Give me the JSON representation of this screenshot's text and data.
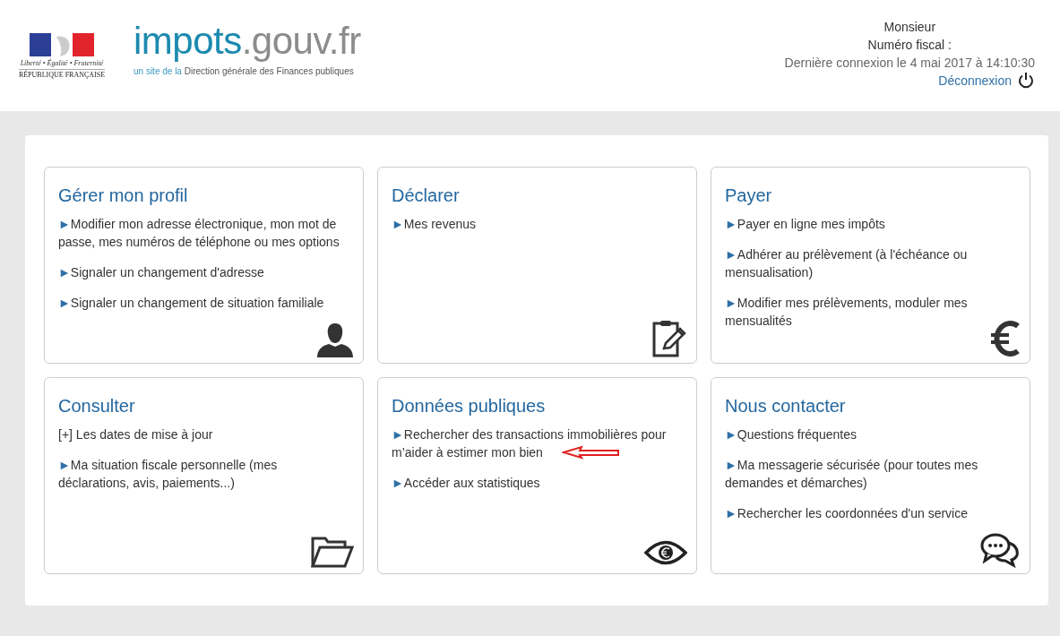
{
  "header": {
    "emblem": {
      "motto": "Liberté • Égalité • Fraternité",
      "name": "RÉPUBLIQUE FRANÇAISE"
    },
    "logo": {
      "brand_main": "impots",
      "brand_rest": ".gouv.fr",
      "tagline_lead": "un site de la",
      "tagline_rest": "Direction générale des Finances publiques"
    },
    "user": {
      "civility": "Monsieur",
      "fiscal_number_label": "Numéro fiscal :",
      "last_login": "Dernière connexion le 4 mai 2017 à 14:10:30",
      "logout": "Déconnexion"
    }
  },
  "cards": [
    {
      "kind": "profile",
      "title": "Gérer mon profil",
      "items": [
        {
          "kind": "link",
          "marker": "►",
          "text": "Modifier mon adresse électronique, mon mot de passe, mes numéros de téléphone ou mes options"
        },
        {
          "kind": "link",
          "marker": "►",
          "text": "Signaler un changement d'adresse"
        },
        {
          "kind": "link",
          "marker": "►",
          "text": "Signaler un changement de situation familiale"
        }
      ]
    },
    {
      "kind": "declare",
      "title": "Déclarer",
      "items": [
        {
          "kind": "link",
          "marker": "►",
          "text": "Mes revenus"
        }
      ]
    },
    {
      "kind": "pay",
      "title": "Payer",
      "items": [
        {
          "kind": "link",
          "marker": "►",
          "text": "Payer en ligne mes impôts"
        },
        {
          "kind": "link",
          "marker": "►",
          "text": "Adhérer au prélèvement (à l'échéance ou mensualisation)"
        },
        {
          "kind": "link",
          "marker": "►",
          "text": "Modifier mes prélèvements, moduler mes mensualités"
        }
      ]
    },
    {
      "kind": "consult",
      "title": "Consulter",
      "items": [
        {
          "kind": "toggle",
          "marker": "[+]",
          "text": "Les dates de mise à jour"
        },
        {
          "kind": "link",
          "marker": "►",
          "text": "Ma situation fiscale personnelle (mes déclarations, avis, paiements...)"
        }
      ]
    },
    {
      "kind": "data",
      "title": "Données publiques",
      "items": [
        {
          "kind": "link",
          "marker": "►",
          "text": "Rechercher des transactions immobilières pour m’aider à estimer mon bien"
        },
        {
          "kind": "link",
          "marker": "►",
          "text": "Accéder aux statistiques"
        }
      ]
    },
    {
      "kind": "contact",
      "title": "Nous contacter",
      "items": [
        {
          "kind": "link",
          "marker": "►",
          "text": "Questions fréquentes"
        },
        {
          "kind": "link",
          "marker": "►",
          "text": "Ma messagerie sécurisée (pour toutes mes demandes et démarches)"
        },
        {
          "kind": "link",
          "marker": "►",
          "text": "Rechercher les coordonnées d'un service"
        }
      ]
    }
  ]
}
